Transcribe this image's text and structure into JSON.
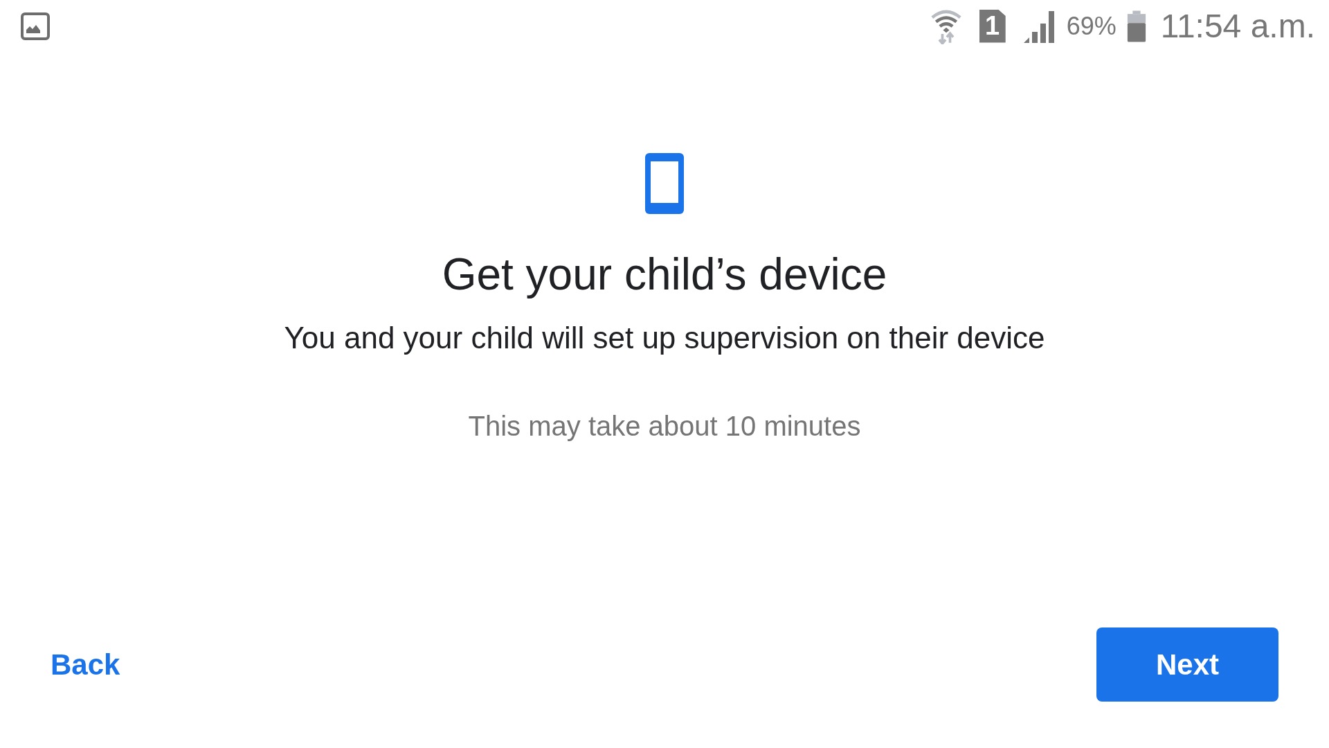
{
  "status_bar": {
    "sim_slot": "1",
    "battery_percent": "69%",
    "time": "11:54 a.m."
  },
  "title": "Get your child’s device",
  "subtitle": "You and your child will set up supervision on their device",
  "note": "This may take about 10 minutes",
  "buttons": [
    {
      "kind": "text",
      "label": "Back"
    },
    {
      "kind": "filled",
      "label": "Next"
    }
  ]
}
